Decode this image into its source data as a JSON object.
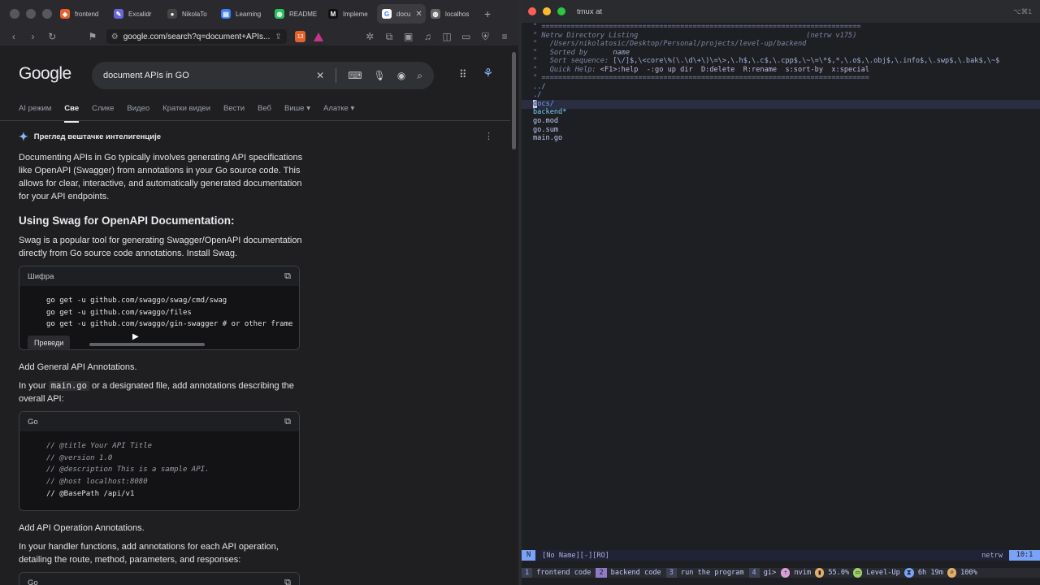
{
  "browser": {
    "tabs": [
      {
        "label": "frontend",
        "icon": "brave-icon",
        "color": "#e8612c"
      },
      {
        "label": "Excalidr",
        "icon": "excalidraw-icon",
        "color": "#6965db"
      },
      {
        "label": "NikolaTo",
        "icon": "github-icon",
        "color": "#444"
      },
      {
        "label": "Learning",
        "icon": "doc-icon",
        "color": "#3b82f6"
      },
      {
        "label": "README",
        "icon": "globe-icon",
        "color": "#22c55e"
      },
      {
        "label": "Impleme",
        "icon": "medium-icon",
        "color": "#222"
      },
      {
        "label": "docu",
        "icon": "google-icon",
        "color": "#4285f4"
      },
      {
        "label": "localhos",
        "icon": "globe-icon",
        "color": "#666"
      }
    ],
    "new_tab": "+",
    "url": "google.com/search?q=document+APIs...",
    "shield_count": "13"
  },
  "google": {
    "logo": "Google",
    "query": "document APIs in GO",
    "tabs": [
      "AI режим",
      "Све",
      "Слике",
      "Видео",
      "Кратки видеи",
      "Вести",
      "Веб",
      "Више ▾",
      "Алатке ▾"
    ],
    "active_tab": "Све",
    "ai_overview_title": "Преглед вештачке интелигенције",
    "intro": "Documenting APIs in Go typically involves generating API specifications like OpenAPI (Swagger) from annotations in your Go source code. This allows for clear, interactive, and automatically generated documentation for your API endpoints.",
    "heading": "Using Swag for OpenAPI Documentation:",
    "swag_para": "Swag is a popular tool for generating Swagger/OpenAPI documentation directly from Go source code annotations. Install Swag.",
    "code1": {
      "lang": "Шифра",
      "lines": [
        "go get -u github.com/swaggo/swag/cmd/swag",
        "go get -u github.com/swaggo/files",
        "go get -u github.com/swaggo/gin-swagger # or other frame"
      ]
    },
    "translate_chip": "Преведи",
    "general_title": "Add General API Annotations.",
    "general_para_pre": "In your ",
    "general_para_code": "main.go",
    "general_para_post": " or a designated file, add annotations describing the overall API:",
    "code2": {
      "lang": "Go",
      "lines": [
        "// @title Your API Title",
        "// @version 1.0",
        "// @description This is a sample API.",
        "// @host localhost:8080",
        "// @BasePath /api/v1"
      ]
    },
    "operation_title": "Add API Operation Annotations.",
    "operation_para": "In your handler functions, add annotations for each API operation, detailing the route, method, parameters, and responses:",
    "code3_lang": "Go"
  },
  "terminal": {
    "title": "tmux at",
    "shortcut": "⌥⌘1",
    "netrw": {
      "rule": "\" ============================================================================",
      "title": "\" Netrw Directory Listing                                        (netrw v175)",
      "path": "\"   /Users/nikolatosic/Desktop/Personal/projects/level-up/backend",
      "sorted_label": "\"   Sorted by      ",
      "sorted_value": "name",
      "sort_seq_label": "\"   Sort sequence: ",
      "sort_seq_value": "[\\/]$,\\<core\\%(\\.\\d\\+\\)\\=\\>,\\.h$,\\.c$,\\.cpp$,\\~\\=\\*$,*,\\.o$,\\.obj$,\\.info$,\\.swp$,\\.bak$,\\~$",
      "help_label": "\"   Quick Help: ",
      "help_items": "<F1>:help  -:go up dir  D:delete  R:rename  s:sort-by  x:special",
      "rule2": "\" ==============================================================================",
      "entries": [
        "../",
        "./",
        "docs/",
        "backend*",
        "go.mod",
        "go.sum",
        "main.go"
      ]
    },
    "status": {
      "mode": "N",
      "file": "[No Name][-][RO]",
      "filetype": "netrw",
      "position": "10:1"
    },
    "tmux": {
      "windows": [
        {
          "num": "1",
          "name": "frontend code"
        },
        {
          "num": "2",
          "name": "backend code"
        },
        {
          "num": "3",
          "name": "run the program"
        },
        {
          "num": "4",
          "name": "gi>"
        }
      ],
      "proc": "nvim",
      "battery": "55.0%",
      "session": "Level-Up",
      "uptime": "6h 19m",
      "zoom": "100%"
    }
  }
}
